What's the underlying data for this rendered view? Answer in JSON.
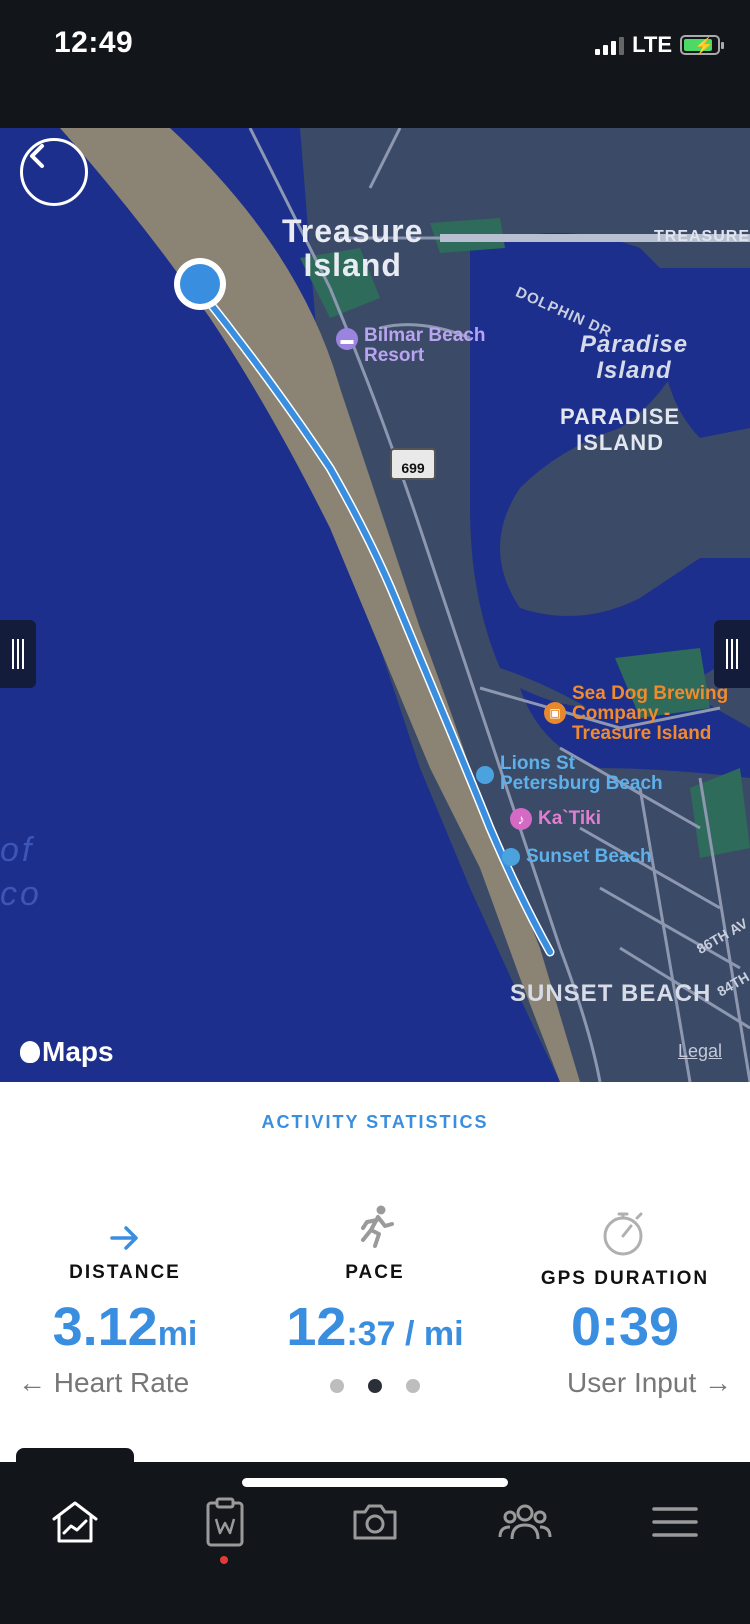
{
  "status_bar": {
    "time": "12:49",
    "network": "LTE",
    "battery_charging": true
  },
  "map": {
    "back_icon": "chevron-left-icon",
    "labels": {
      "treasure_island_line1": "Treasure",
      "treasure_island_line2": "Island",
      "treasure_road": "TREASURE",
      "dolphin_dr": "DOLPHIN DR",
      "paradise_island_italic_line1": "Paradise",
      "paradise_island_italic_line2": "Island",
      "paradise_island_caps_line1": "PARADISE",
      "paradise_island_caps_line2": "ISLAND",
      "bilmar_line1": "Bilmar Beach",
      "bilmar_line2": "Resort",
      "route_shield": "699",
      "sea_dog_line1": "Sea Dog Brewing",
      "sea_dog_line2": "Company -",
      "sea_dog_line3": "Treasure Island",
      "lions_line1": "Lions St",
      "lions_line2": "Petersburg Beach",
      "ka_tiki": "Ka`Tiki",
      "sunset_beach_poi": "Sunset Beach",
      "sunset_beach_area": "SUNSET BEACH",
      "gulf_line1": "of",
      "gulf_line2": "co",
      "ave_86th": "86TH AV",
      "ave_84th": "84TH",
      "maps_brand": "Maps",
      "legal": "Legal"
    },
    "colors": {
      "water": "#1d2f8c",
      "beach": "#8b8374",
      "land": "#3b4a66",
      "route": "#3a8ee0"
    }
  },
  "stats": {
    "title": "ACTIVITY STATISTICS",
    "distance": {
      "label": "DISTANCE",
      "value": "3.12",
      "unit": "mi",
      "icon": "arrow-right-icon"
    },
    "pace": {
      "label": "PACE",
      "value": "12",
      "unit": ":37 / mi",
      "icon": "runner-icon"
    },
    "gps_duration": {
      "label": "GPS DURATION",
      "value": "0:39",
      "icon": "stopwatch-icon"
    },
    "prev_link": "← Heart Rate",
    "next_link": "User Input →",
    "page_index": 2,
    "page_count": 3
  },
  "tab_bar": {
    "tabs": [
      {
        "name": "home",
        "icon": "home-chart-icon"
      },
      {
        "name": "workouts",
        "icon": "clipboard-icon",
        "has_notification": true
      },
      {
        "name": "camera",
        "icon": "camera-icon"
      },
      {
        "name": "community",
        "icon": "group-icon"
      },
      {
        "name": "menu",
        "icon": "hamburger-menu-icon"
      }
    ]
  }
}
